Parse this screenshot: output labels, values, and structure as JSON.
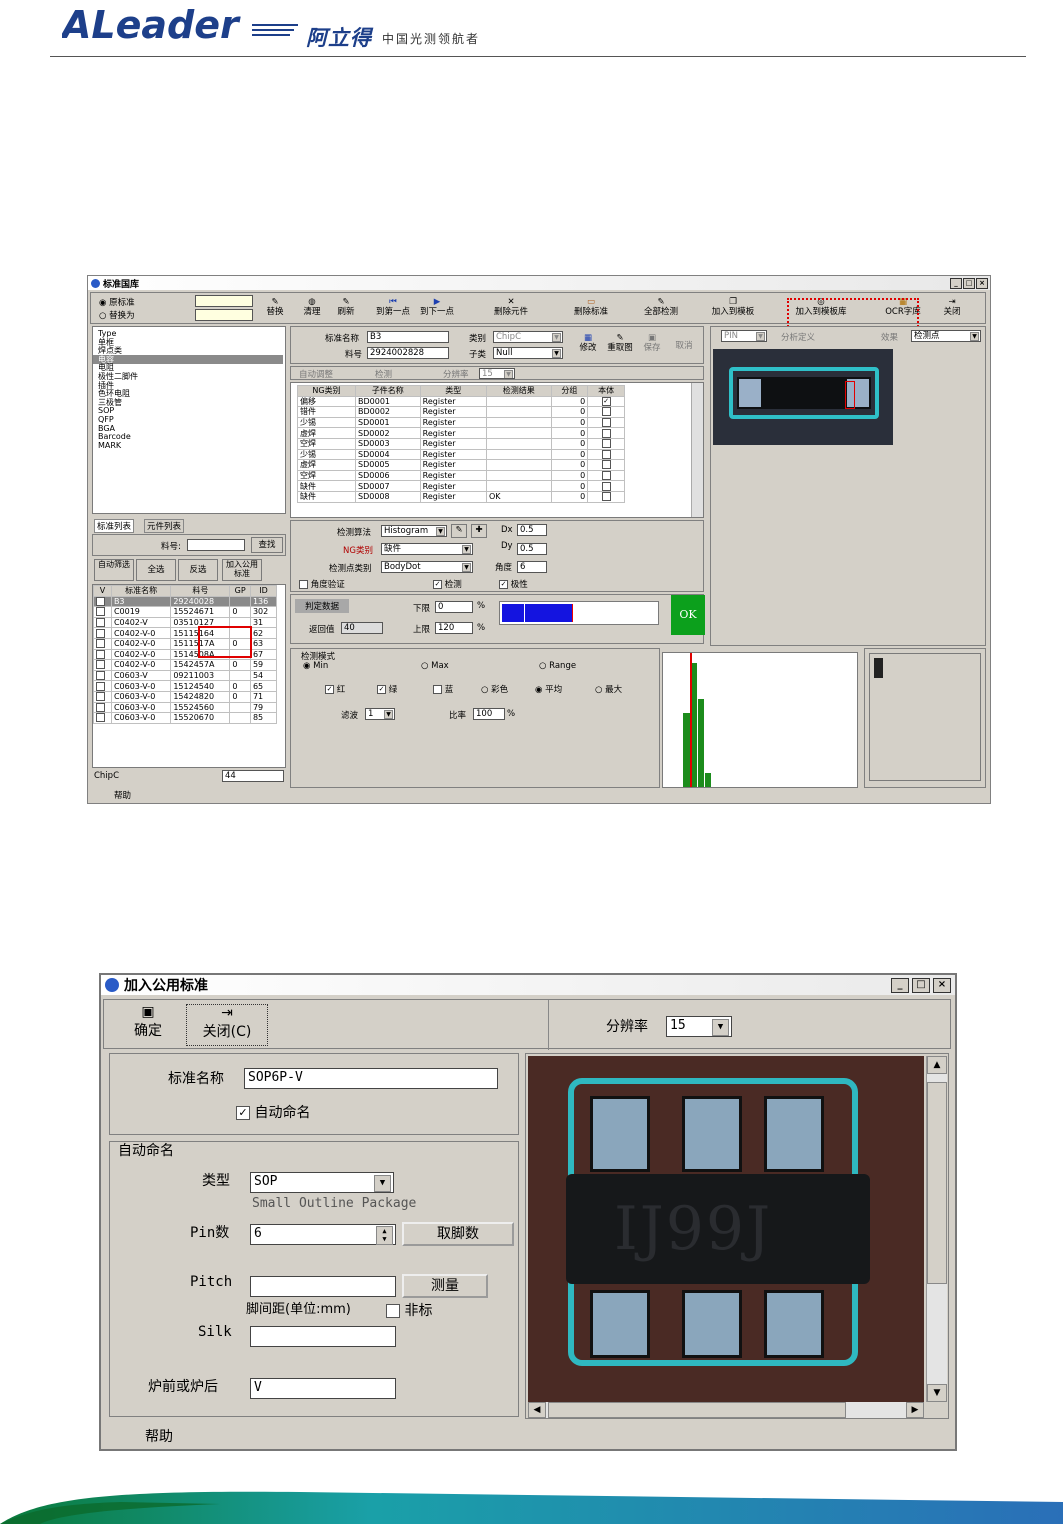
{
  "header": {
    "logo_text": "ALeader",
    "brand_cn": "阿立得",
    "slogan": "中国光测领航者"
  },
  "win1": {
    "title": "标准国库",
    "radios": [
      {
        "label": "原标准",
        "selected": true
      },
      {
        "label": "替换为",
        "selected": false
      }
    ],
    "toolbar": [
      "替换",
      "清理",
      "刷新",
      "到第一点",
      "到下一点",
      "删除元件",
      "删除标准",
      "全部检测",
      "加入到模板",
      "加入到模板库",
      "OCR字库",
      "关闭"
    ],
    "tree": [
      "Type",
      "单框",
      "焊点类",
      "电容",
      "电阻",
      "极性二脚件",
      "插件",
      "色环电阻",
      "三极管",
      "SOP",
      "QFP",
      "BGA",
      "Barcode",
      "MARK"
    ],
    "tree_selected": 3,
    "tabs": [
      "标准列表",
      "元件列表"
    ],
    "search_label": "料号:",
    "search_btn": "查找",
    "list_btns": [
      "自动筛选",
      "全选",
      "反选",
      "加入公用标准"
    ],
    "list_cols": [
      "V",
      "标准名称",
      "料号",
      "GP",
      "ID"
    ],
    "list_rows": [
      [
        "",
        "B3",
        "29240028",
        "",
        "136"
      ],
      [
        "",
        "C0019",
        "15524671",
        "0",
        "302"
      ],
      [
        "",
        "C0402-V",
        "03510127",
        "",
        "31"
      ],
      [
        "",
        "C0402-V-0",
        "15115164",
        "",
        "62"
      ],
      [
        "",
        "C0402-V-0",
        "1511517A",
        "0",
        "63"
      ],
      [
        "",
        "C0402-V-0",
        "1514508A",
        "",
        "67"
      ],
      [
        "",
        "C0402-V-0",
        "1542457A",
        "0",
        "59"
      ],
      [
        "",
        "C0603-V",
        "09211003",
        "",
        "54"
      ],
      [
        "",
        "C0603-V-0",
        "15124540",
        "0",
        "65"
      ],
      [
        "",
        "C0603-V-0",
        "15424820",
        "0",
        "71"
      ],
      [
        "",
        "C0603-V-0",
        "15524560",
        "",
        "79"
      ],
      [
        "",
        "C0603-V-0",
        "15520670",
        "",
        "85"
      ]
    ],
    "bottom_left": "ChipC",
    "bottom_count": "44",
    "status": "帮助",
    "std_name_label": "标准名称",
    "std_name": "B3",
    "part_label": "料号",
    "part": "2924002828",
    "class_label": "类别",
    "class": "ChipC",
    "sub_label": "子类",
    "sub": "Null",
    "edit_btns": [
      "修改",
      "重取图",
      "保存",
      "取消"
    ],
    "tabs2": [
      "自动调整",
      "检测"
    ],
    "res_label": "分辨率",
    "res": "15",
    "ng_cols": [
      "NG类别",
      "子件名称",
      "类型",
      "检测结果",
      "分组",
      "本体"
    ],
    "ng_rows": [
      [
        "偏移",
        "BD0001",
        "Register",
        "",
        "0",
        "✓"
      ],
      [
        "错件",
        "BD0002",
        "Register",
        "",
        "0",
        ""
      ],
      [
        "少锡",
        "SD0001",
        "Register",
        "",
        "0",
        ""
      ],
      [
        "虚焊",
        "SD0002",
        "Register",
        "",
        "0",
        ""
      ],
      [
        "空焊",
        "SD0003",
        "Register",
        "",
        "0",
        ""
      ],
      [
        "少锡",
        "SD0004",
        "Register",
        "",
        "0",
        ""
      ],
      [
        "虚焊",
        "SD0005",
        "Register",
        "",
        "0",
        ""
      ],
      [
        "空焊",
        "SD0006",
        "Register",
        "",
        "0",
        ""
      ],
      [
        "缺件",
        "SD0007",
        "Register",
        "",
        "0",
        ""
      ],
      [
        "缺件",
        "SD0008",
        "Register",
        "OK",
        "0",
        ""
      ]
    ],
    "algo_label": "检测算法",
    "algo": "Histogram",
    "ng_label": "NG类别",
    "ng": "缺件",
    "pt_label": "检测点类别",
    "pt": "BodyDot",
    "angle_chk": "角度验证",
    "dx_label": "Dx",
    "dx": "0.5",
    "dy_label": "Dy",
    "dy": "0.5",
    "ang_label": "角度",
    "ang": "6",
    "detect_chk": "检测",
    "polar_chk": "极性",
    "judge_label": "判定数据",
    "ret_label": "返回值",
    "ret": "40",
    "low_label": "下限",
    "low": "0",
    "high_label": "上限",
    "high": "120",
    "pct": "%",
    "ok": "OK",
    "mode_label": "检测模式",
    "modes": [
      "Min",
      "Max",
      "Range"
    ],
    "colors": [
      "红",
      "绿",
      "蓝"
    ],
    "color_opts": [
      "彩色",
      "平均",
      "最大"
    ],
    "filter_label": "滤波",
    "filter": "1",
    "ratio_label": "比率",
    "ratio": "100",
    "right_sel": "PIN",
    "right_lbl1": "分析定义",
    "right_lbl2": "效果",
    "right_sel2": "检测点"
  },
  "win2": {
    "title": "加入公用标准",
    "btn_ok": "确定",
    "btn_close": "关闭(C)",
    "res_label": "分辨率",
    "res": "15",
    "std_name_label": "标准名称",
    "std_name": "SOP6P-V",
    "auto_chk": "自动命名",
    "group_label": "自动命名",
    "type_label": "类型",
    "type": "SOP",
    "type_desc": "Small Outline Package",
    "pin_label": "Pin数",
    "pin": "6",
    "pin_btn": "取脚数",
    "pitch_label": "Pitch",
    "pitch": "",
    "measure_btn": "测量",
    "pitch_desc": "脚间距(单位:mm)",
    "nonstd": "非标",
    "silk_label": "Silk",
    "silk": "",
    "oven_label": "炉前或炉后",
    "oven": "V",
    "chip_text": "IJ99J",
    "status": "帮助"
  }
}
